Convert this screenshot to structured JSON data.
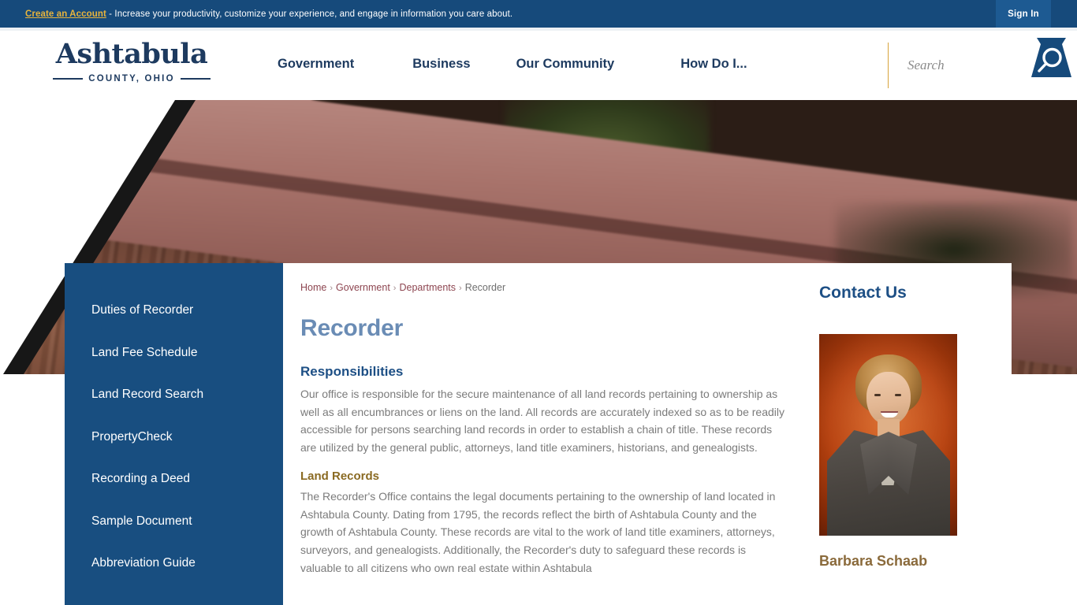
{
  "topbar": {
    "account_link": "Create an Account",
    "message": " - Increase your productivity, customize your experience, and engage in information you care about.",
    "signin_label": "Sign In"
  },
  "header": {
    "logo_word": "Ashtabula",
    "logo_sub": "COUNTY, OHIO",
    "nav": [
      {
        "label": "Government"
      },
      {
        "label": "Business"
      },
      {
        "label": "Our Community"
      },
      {
        "label": "How Do I..."
      }
    ],
    "search": {
      "placeholder": "Search",
      "value": "",
      "icon": "search-icon"
    }
  },
  "sidebar": {
    "items": [
      {
        "label": "Duties of Recorder"
      },
      {
        "label": "Land Fee Schedule"
      },
      {
        "label": "Land Record Search"
      },
      {
        "label": "PropertyCheck"
      },
      {
        "label": "Recording a Deed"
      },
      {
        "label": "Sample Document"
      },
      {
        "label": "Abbreviation Guide"
      }
    ]
  },
  "main": {
    "breadcrumb": [
      {
        "label": "Home",
        "current": false
      },
      {
        "label": "Government",
        "current": false
      },
      {
        "label": "Departments",
        "current": false
      },
      {
        "label": "Recorder",
        "current": true
      }
    ],
    "breadcrumb_separator": "›",
    "page_title": "Recorder",
    "sections": [
      {
        "heading": "Responsibilities",
        "body": "Our office is responsible for the secure maintenance of all land records pertaining to ownership as well as all encumbrances or liens on the land. All records are accurately indexed so as to be readily accessible for persons searching land records in order to establish a chain of title. These records are utilized by the general public, attorneys, land title examiners, historians, and genealogists."
      },
      {
        "heading": "Land Records",
        "body": "The Recorder's Office contains the legal documents pertaining to the ownership of land located in Ashtabula County. Dating from 1795, the records reflect the birth of Ashtabula County and the growth of Ashtabula County. These records are vital to the work of land title examiners, attorneys, surveyors, and genealogists. Additionally, the Recorder's duty to safeguard these records is valuable to all citizens who own real estate within Ashtabula"
      }
    ]
  },
  "rail": {
    "title": "Contact Us",
    "person_name": "Barbara Schaab",
    "portrait_alt": "portrait-photo"
  },
  "colors": {
    "topbar_blue": "#164a7b",
    "accent_gold": "#e8b43c",
    "sidebar_blue": "#184e80",
    "navy": "#1d3a5f",
    "title_blue": "#6a8cb5",
    "section_blue": "#1d4f85",
    "subheading_gold": "#8a6a22",
    "breadcrumb_link": "#8d4550",
    "body_gray": "#7b7b7b",
    "name_brown": "#8a6a3b"
  }
}
